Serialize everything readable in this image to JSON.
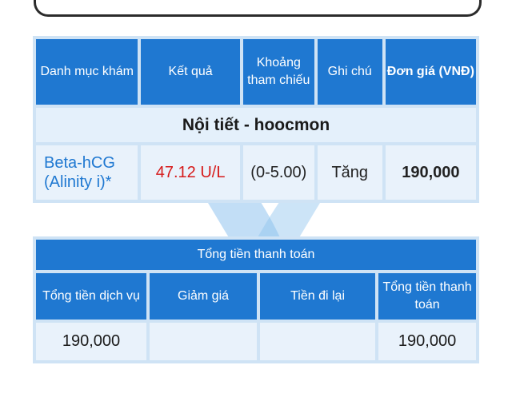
{
  "table1": {
    "headers": [
      "Danh mục khám",
      "Kết quả",
      "Khoảng tham chiếu",
      "Ghi chú",
      "Đơn giá (VNĐ)"
    ],
    "section": "Nội tiết - hoocmon",
    "row": {
      "test_name": "Beta-hCG (Alinity i)*",
      "result": "47.12 U/L",
      "reference": "(0-5.00)",
      "note": "Tăng",
      "price": "190,000"
    }
  },
  "table2": {
    "title": "Tổng tiền thanh toán",
    "headers": [
      "Tổng tiền dịch vụ",
      "Giảm giá",
      "Tiền đi lại",
      "Tổng tiền thanh toán"
    ],
    "values": [
      "190,000",
      "",
      "",
      "190,000"
    ]
  },
  "colors": {
    "header_blue": "#1f78d1",
    "result_red": "#d61a1a"
  }
}
